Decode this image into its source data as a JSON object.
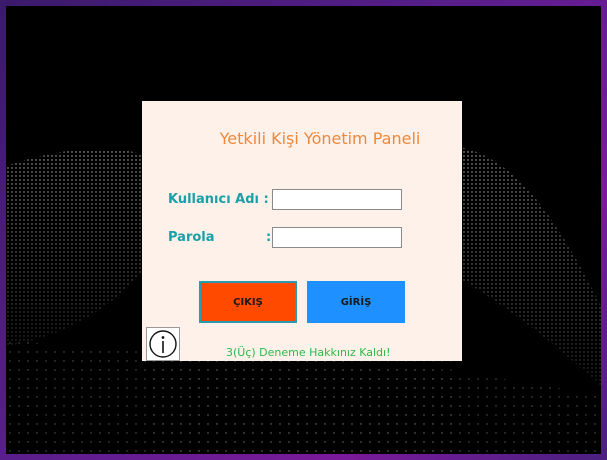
{
  "panel": {
    "title": "Yetkili Kişi Yönetim Paneli",
    "username_label": "Kullanıcı Adı :",
    "password_label": "Parola",
    "password_colon": ":",
    "username_value": "",
    "password_value": ""
  },
  "buttons": {
    "exit_label": "ÇIKIŞ",
    "login_label": "GİRİŞ"
  },
  "status": {
    "attempts_text": "3(Üç) Deneme Hakkınız Kaldı!"
  },
  "icons": {
    "info": "info-icon"
  },
  "colors": {
    "title": "#f0883a",
    "labels": "#1aa0a8",
    "exit_button": "#ff4a00",
    "login_button": "#1e90ff",
    "status_text": "#2eb84a",
    "panel_bg": "#fdf1ea"
  }
}
